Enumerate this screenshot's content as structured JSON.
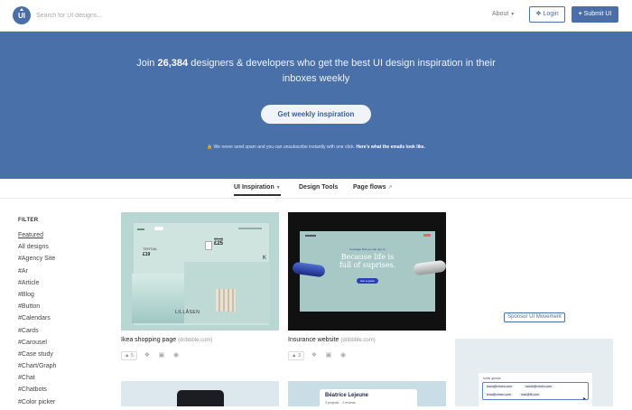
{
  "header": {
    "logo_text": "UI",
    "search_placeholder": "Search for UI designs...",
    "about_label": "About",
    "login_label": "Login",
    "submit_label": "Submit UI"
  },
  "hero": {
    "headline_pre": "Join ",
    "subscriber_count": "26,384",
    "headline_post": " designers & developers who get the best UI design inspiration in their inboxes weekly",
    "cta_label": "Get weekly inspiration",
    "note_text": "We never send spam and you can unsubscribe instantly with one click.",
    "note_link": "Here's what the emails look like."
  },
  "tabs": [
    {
      "label": "UI Inspiration",
      "active": true
    },
    {
      "label": "Design Tools",
      "active": false
    },
    {
      "label": "Page flows",
      "active": false
    }
  ],
  "filter": {
    "title": "FILTER",
    "items": [
      "Featured",
      "All designs",
      "#Agency Site",
      "#Ar",
      "#Article",
      "#Blog",
      "#Button",
      "#Calendars",
      "#Cards",
      "#Carousel",
      "#Case study",
      "#Chart/Graph",
      "#Chat",
      "#Chatbots",
      "#Color picker"
    ]
  },
  "cards": [
    {
      "title": "Ikea shopping page",
      "source": "(dribbble.com)",
      "likes": "5",
      "thumb_text": {
        "price_old": "33,45",
        "price_new": "£25",
        "tertial": "TERTIAL",
        "tertial_price": "£19",
        "brand": "LILLÅSEN",
        "side_letter": "K"
      }
    },
    {
      "title": "Insurance website",
      "source": "(dribbble.com)",
      "likes": "3",
      "thumb_text": {
        "kicker": "Coverage that you can rely on",
        "headline": "Because life is full of suprises.",
        "cta": "Get a quote"
      }
    }
  ],
  "sponsor_label": "Sponsor UI Movement",
  "bottom_cards": {
    "profile_name": "Béatrice Lejeune",
    "profile_stat_1": "3 projects",
    "profile_stat_2": "2 reviews",
    "invite_label": "Invite guests",
    "emails": [
      "laura@vimeo.com",
      "sarah@vimeo.com",
      "lena@vimeo.com",
      "nick@fit.com"
    ]
  },
  "colors": {
    "brand": "#4a70aa",
    "header_bg": "#ffffff"
  }
}
